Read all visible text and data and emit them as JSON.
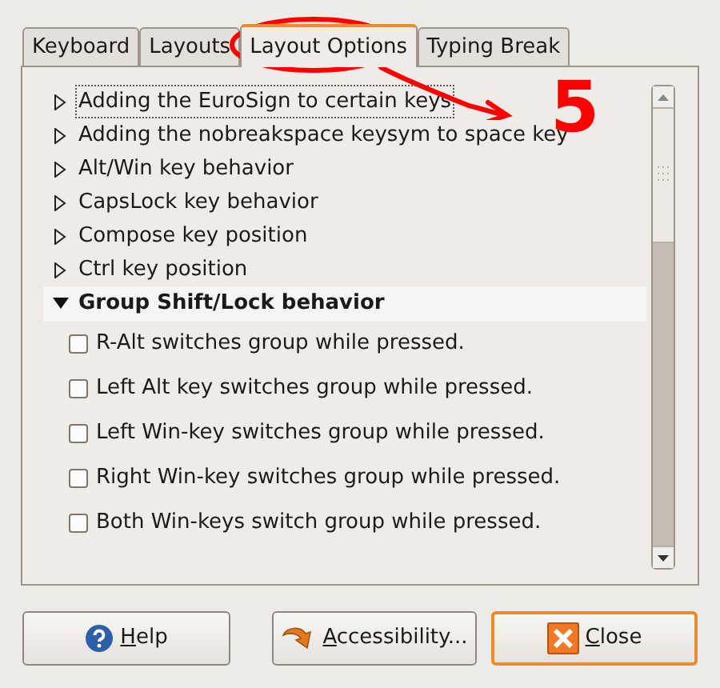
{
  "tabs": [
    {
      "label": "Keyboard",
      "selected": false
    },
    {
      "label": "Layouts",
      "selected": false
    },
    {
      "label": "Layout Options",
      "selected": true
    },
    {
      "label": "Typing Break",
      "selected": false
    }
  ],
  "options": [
    {
      "label": "Adding the EuroSign to certain keys",
      "expanded": false,
      "focused": true
    },
    {
      "label": "Adding the nobreakspace keysym to space key",
      "expanded": false,
      "focused": false
    },
    {
      "label": "Alt/Win key behavior",
      "expanded": false,
      "focused": false
    },
    {
      "label": "CapsLock key behavior",
      "expanded": false,
      "focused": false
    },
    {
      "label": "Compose key position",
      "expanded": false,
      "focused": false
    },
    {
      "label": "Ctrl key position",
      "expanded": false,
      "focused": false
    },
    {
      "label": "Group Shift/Lock behavior",
      "expanded": true,
      "focused": false,
      "children": [
        {
          "label": "R-Alt switches group while pressed.",
          "checked": false
        },
        {
          "label": "Left Alt key switches group while pressed.",
          "checked": false
        },
        {
          "label": "Left Win-key switches group while pressed.",
          "checked": false
        },
        {
          "label": "Right Win-key switches group while pressed.",
          "checked": false
        },
        {
          "label": "Both Win-keys switch group while pressed.",
          "checked": false
        }
      ]
    }
  ],
  "buttons": [
    {
      "label": "Help",
      "kind": "help",
      "default": false
    },
    {
      "label": "Accessibility...",
      "kind": "accessibility",
      "default": false
    },
    {
      "label": "Close",
      "kind": "close",
      "default": true
    }
  ],
  "annotation": {
    "label": "5"
  }
}
